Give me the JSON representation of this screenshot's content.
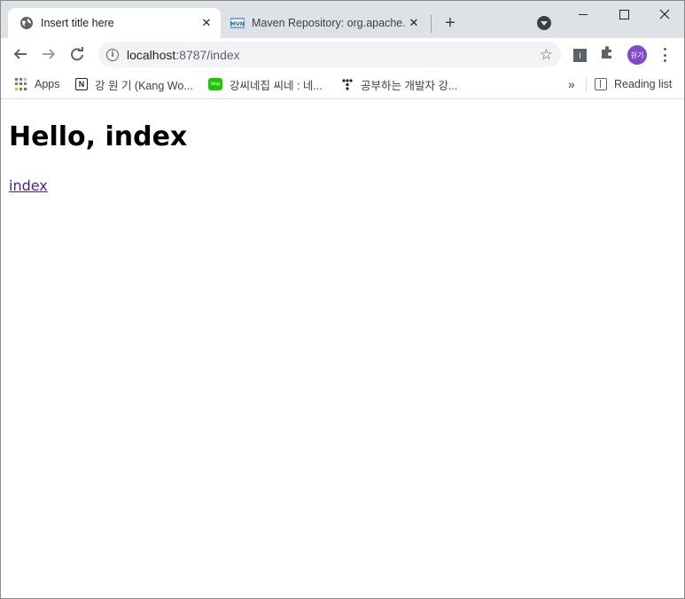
{
  "tabs": [
    {
      "title": "Insert title here",
      "active": true
    },
    {
      "title": "Maven Repository: org.apache.t",
      "active": false
    }
  ],
  "toolbar": {
    "url_host": "localhost",
    "url_rest": ":8787/index",
    "profile_initials": "원기",
    "extension_label": "I"
  },
  "bookmarks": {
    "items": [
      {
        "label": "Apps",
        "icon": "apps-grid-icon"
      },
      {
        "label": "강 원 기 (Kang Wo...",
        "icon": "notion-icon"
      },
      {
        "label": "강씨네집 씨네 : 네...",
        "icon": "naver-blog-icon"
      },
      {
        "label": "공부하는 개발자 강...",
        "icon": "tistory-icon"
      }
    ],
    "reading_list": "Reading list",
    "overflow": "»"
  },
  "page": {
    "heading": "Hello, index",
    "link": "index"
  },
  "colors": {
    "tabstrip": "#dee1e6",
    "avatar": "#8148c8",
    "visited_link": "#551a8b"
  }
}
